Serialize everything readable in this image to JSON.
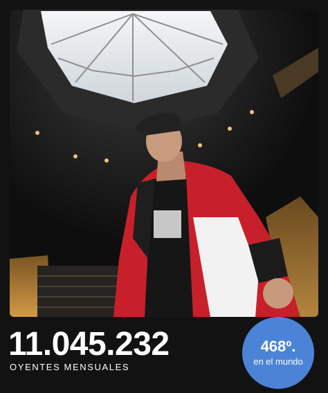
{
  "artist_image": {
    "alt": "Artist photo under skylight",
    "colors": {
      "skylight": "#e8ecef",
      "ceiling": "#2a2a2a",
      "jacket_red": "#c8202a",
      "jacket_white": "#f2f2f2",
      "background": "#151515",
      "warm_light": "#c9923e"
    }
  },
  "stats": {
    "monthly_listeners": "11.045.232",
    "monthly_listeners_label": "OYENTES MENSUALES"
  },
  "world_rank": {
    "value": "468º.",
    "label": "en el mundo",
    "color": "#4b84d6"
  }
}
